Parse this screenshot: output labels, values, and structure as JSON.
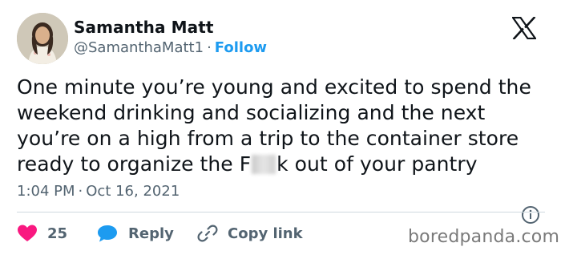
{
  "author": {
    "name": "Samantha Matt",
    "handle": "@SamanthaMatt1",
    "separator": "·",
    "follow_label": "Follow"
  },
  "tweet": {
    "lines": [
      "One minute you’re young and excited to spend the",
      "weekend drinking and socializing and the next",
      "you’re on a high from a trip to the container store",
      "ready to organize the F"
    ],
    "line4_tail": "k out of your pantry",
    "time": "1:04 PM",
    "date_separator": "·",
    "date": "Oct 16, 2021"
  },
  "actions": {
    "like_count": "25",
    "reply_label": "Reply",
    "copy_link_label": "Copy link"
  },
  "icons": {
    "like": "heart-icon",
    "reply": "speech-bubble-icon",
    "copy_link": "link-icon",
    "info": "info-icon",
    "brand": "x-logo-icon"
  },
  "colors": {
    "like": "#f91880",
    "reply": "#1d9bf0",
    "follow": "#1d9bf0",
    "secondary_text": "#536471"
  },
  "watermark": "boredpanda.com"
}
